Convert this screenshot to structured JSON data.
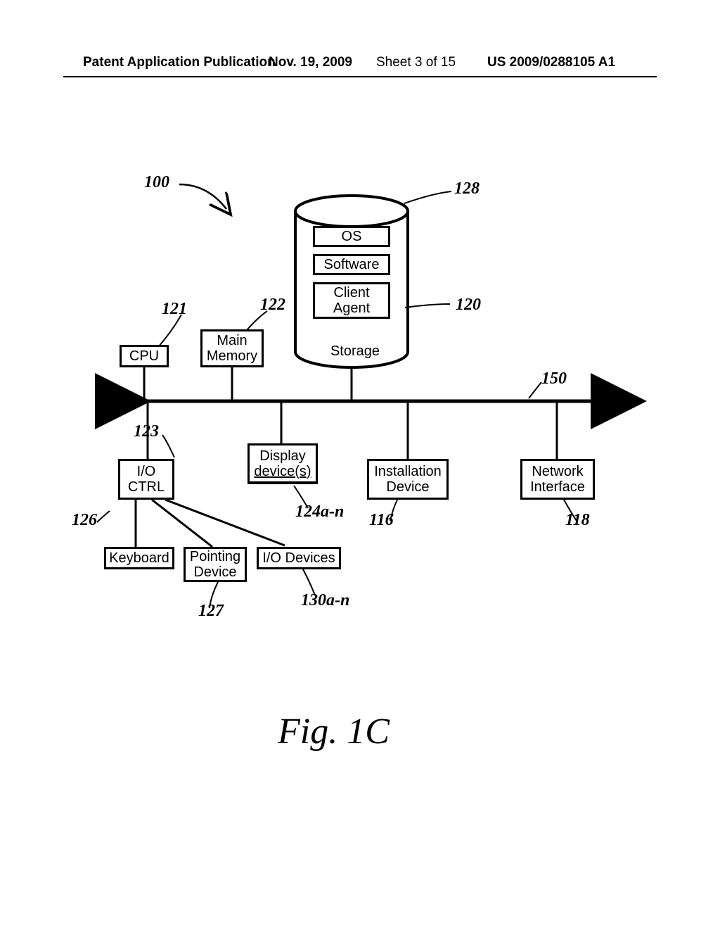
{
  "header": {
    "pubType": "Patent Application Publication",
    "date": "Nov. 19, 2009",
    "sheet": "Sheet 3 of 15",
    "pubNo": "US 2009/0288105 A1"
  },
  "refs": {
    "r100": "100",
    "r128": "128",
    "r121": "121",
    "r122": "122",
    "r120": "120",
    "r150": "150",
    "r123": "123",
    "r126": "126",
    "r124an": "124a-n",
    "r116": "116",
    "r118": "118",
    "r127": "127",
    "r130an": "130a-n"
  },
  "labels": {
    "os": "OS",
    "software": "Software",
    "clientAgent1": "Client",
    "clientAgent2": "Agent",
    "storage": "Storage",
    "cpu": "CPU",
    "mainMem1": "Main",
    "mainMem2": "Memory",
    "ioctrl1": "I/O",
    "ioctrl2": "CTRL",
    "display1": "Display",
    "display2": "device(s)",
    "install1": "Installation",
    "install2": "Device",
    "net1": "Network",
    "net2": "Interface",
    "keyboard": "Keyboard",
    "pointing1": "Pointing",
    "pointing2": "Device",
    "iodev": "I/O Devices"
  },
  "figure": "Fig. 1C"
}
